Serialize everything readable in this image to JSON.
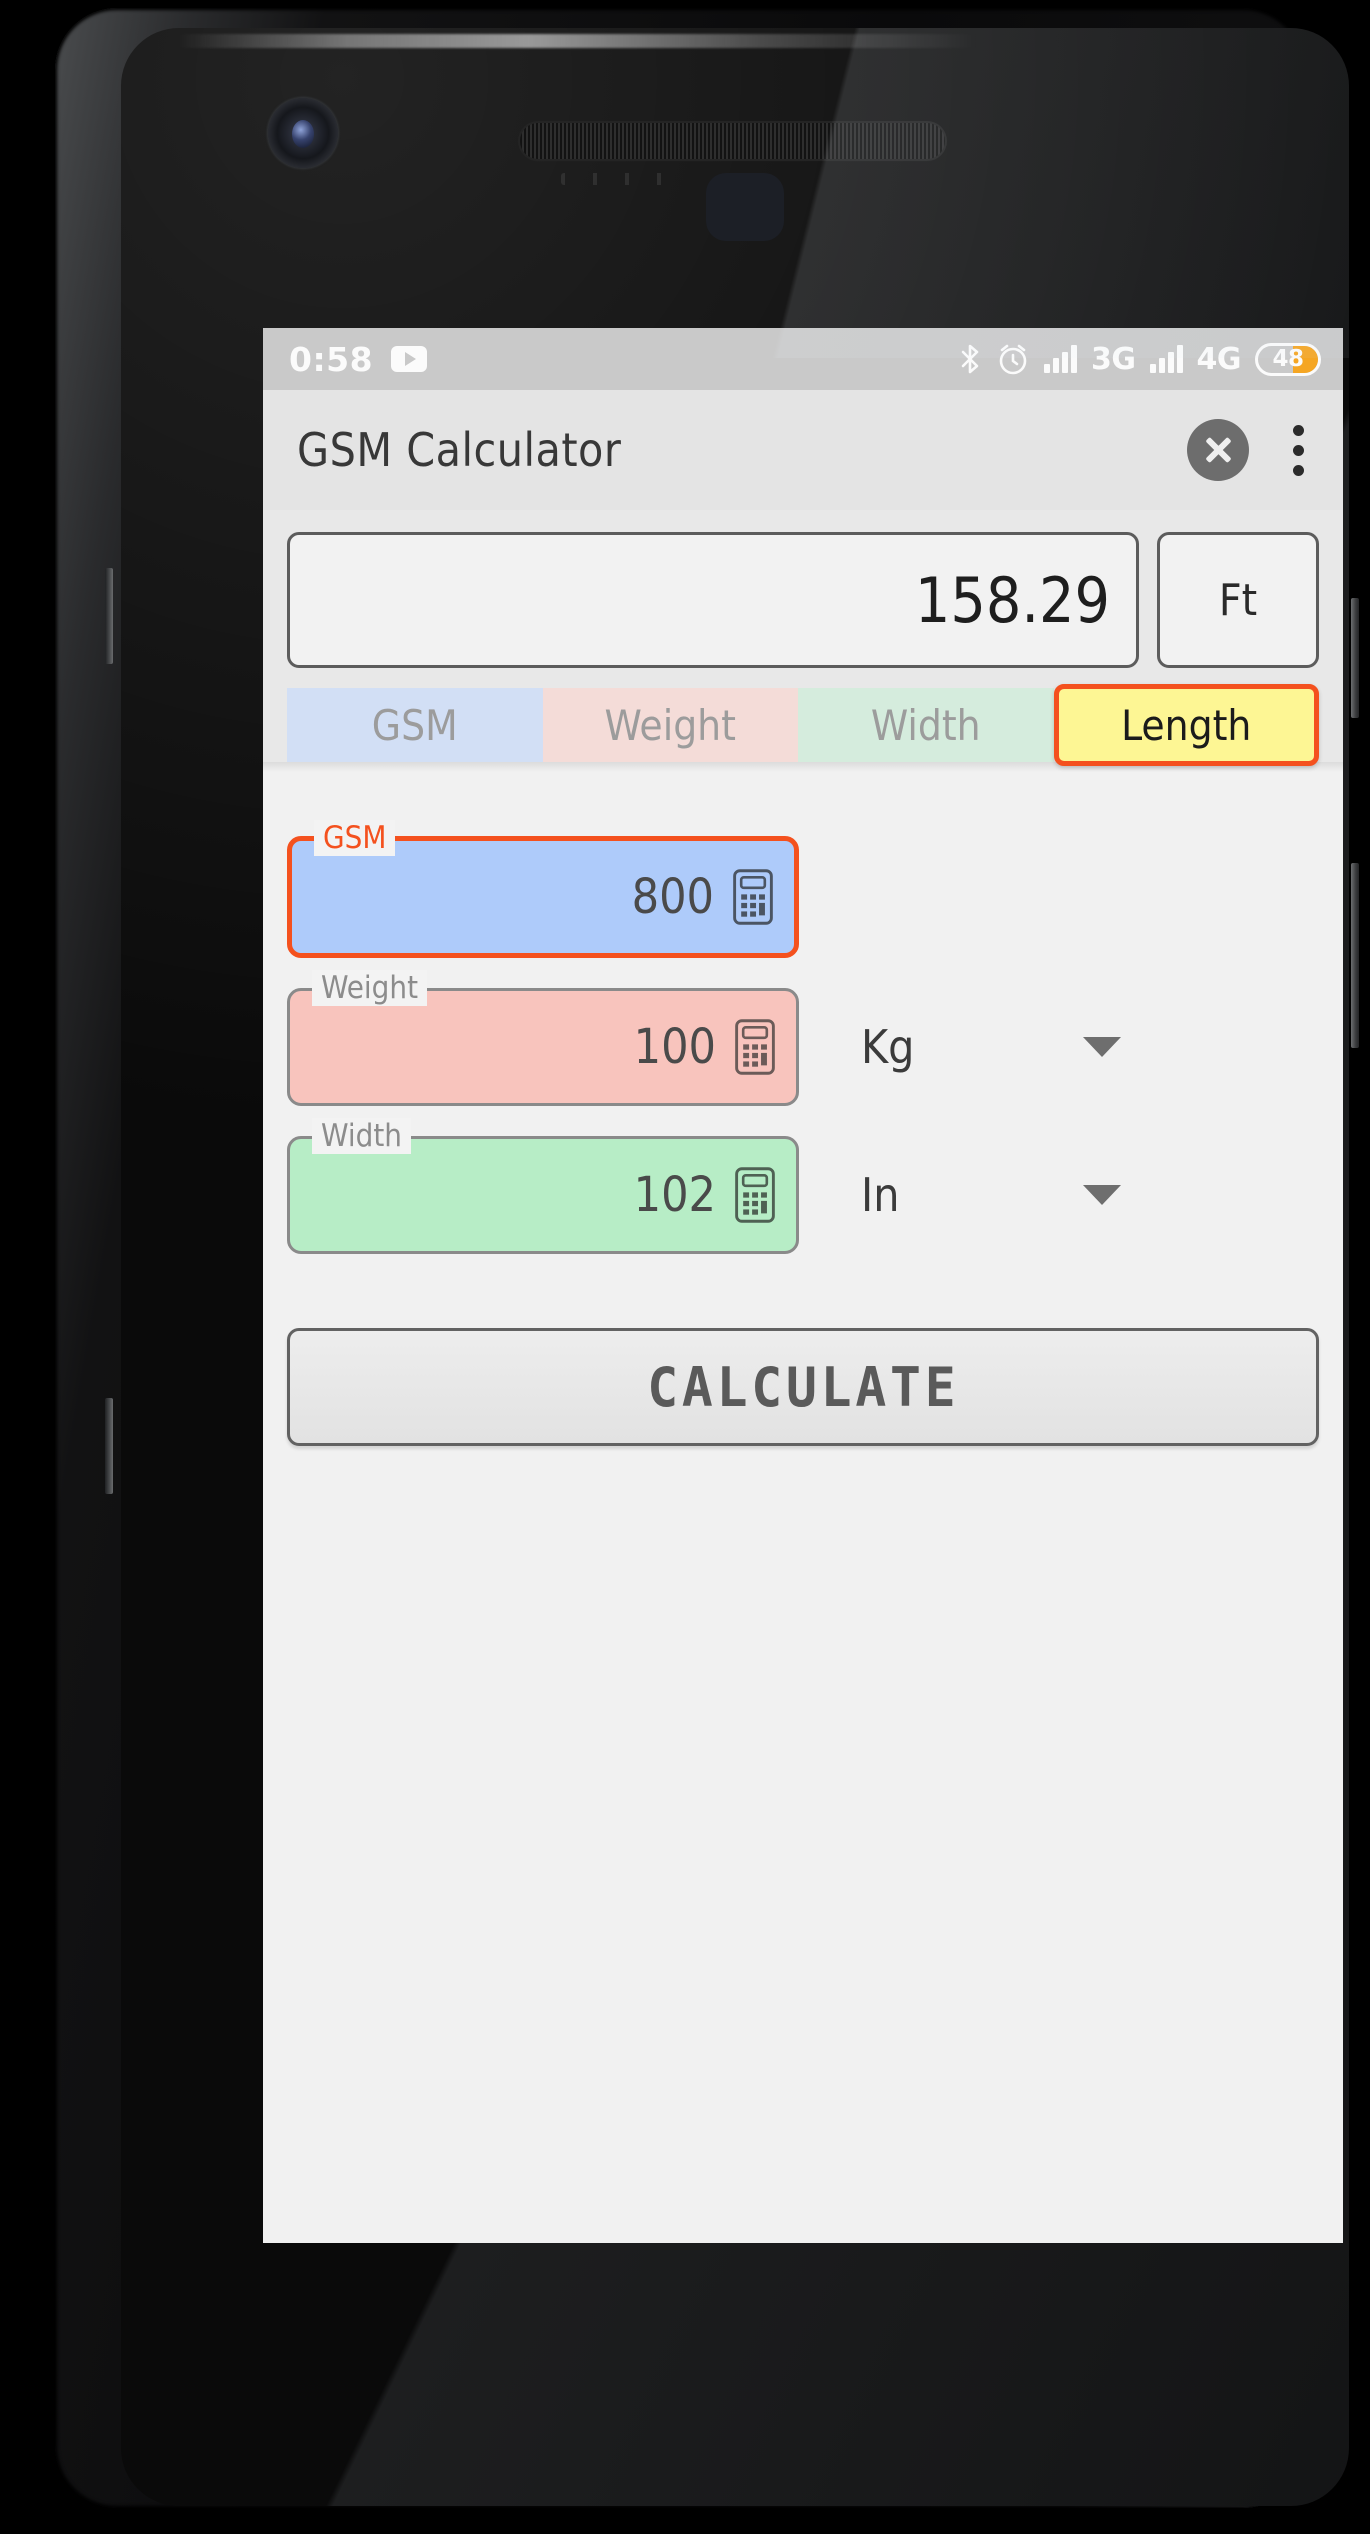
{
  "device": {
    "front_camera": "front-camera",
    "earpiece": "earpiece-speaker",
    "bottom_speaker": "bottom-speaker"
  },
  "status_bar": {
    "clock": "0:58",
    "media_icon": "youtube-icon",
    "icons": [
      "bluetooth-icon",
      "alarm-icon"
    ],
    "networks": [
      {
        "label": "3G",
        "bars": 4
      },
      {
        "label": "4G",
        "bars": 4
      }
    ],
    "battery": {
      "percent": "48",
      "level": 48,
      "color": "#f5a623"
    },
    "background": "#c9c9c9"
  },
  "app_bar": {
    "title": "GSM Calculator",
    "close_icon": "close-circle-icon",
    "overflow_icon": "more-vertical-icon",
    "background": "#e4e4e4"
  },
  "result": {
    "value": "158.29",
    "unit": "Ft"
  },
  "tabs": [
    {
      "label": "GSM",
      "color": "#d2dff5",
      "selected": false
    },
    {
      "label": "Weight",
      "color": "#f4dcd8",
      "selected": false
    },
    {
      "label": "Width",
      "color": "#d5ecdd",
      "selected": false
    },
    {
      "label": "Length",
      "color": "#fdf694",
      "selected": true
    }
  ],
  "accent_color": "#f4511e",
  "fields": [
    {
      "label": "GSM",
      "value": "800",
      "fill": "#aecbfa",
      "focused": true,
      "icon": "calculator-icon",
      "unit": null
    },
    {
      "label": "Weight",
      "value": "100",
      "fill": "#f8c4bd",
      "focused": false,
      "icon": "calculator-icon",
      "unit": "Kg"
    },
    {
      "label": "Width",
      "value": "102",
      "fill": "#b7edc6",
      "focused": false,
      "icon": "calculator-icon",
      "unit": "In"
    }
  ],
  "calculate": {
    "label": "CALCULATE"
  }
}
